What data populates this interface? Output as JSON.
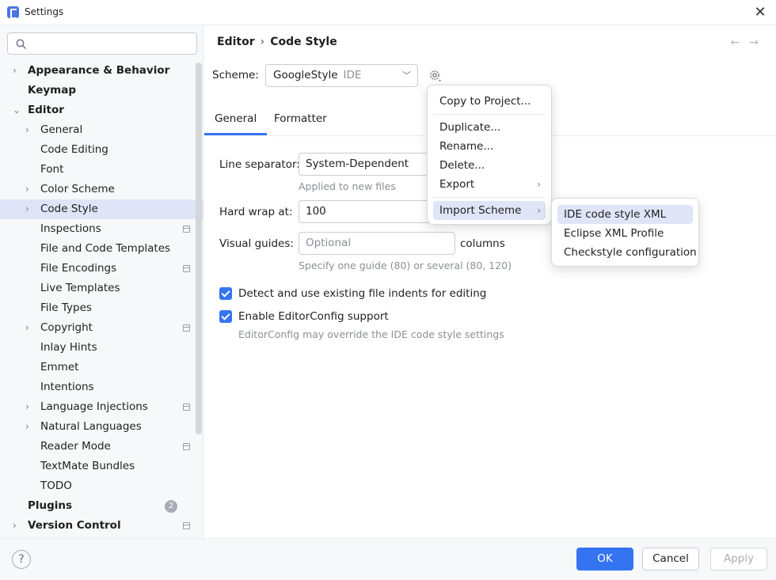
{
  "window": {
    "title": "Settings"
  },
  "sidebar": {
    "search_placeholder": "",
    "items": [
      {
        "label": "Appearance & Behavior",
        "level": 0,
        "bold": true,
        "expandable": true,
        "expanded": false
      },
      {
        "label": "Keymap",
        "level": 0,
        "bold": true,
        "expandable": false
      },
      {
        "label": "Editor",
        "level": 0,
        "bold": true,
        "expandable": true,
        "expanded": true
      },
      {
        "label": "General",
        "level": 1,
        "expandable": true,
        "expanded": false
      },
      {
        "label": "Code Editing",
        "level": 1,
        "expandable": false
      },
      {
        "label": "Font",
        "level": 1,
        "expandable": false
      },
      {
        "label": "Color Scheme",
        "level": 1,
        "expandable": true,
        "expanded": false
      },
      {
        "label": "Code Style",
        "level": 1,
        "expandable": true,
        "expanded": false,
        "selected": true
      },
      {
        "label": "Inspections",
        "level": 1,
        "expandable": false,
        "project_icon": true
      },
      {
        "label": "File and Code Templates",
        "level": 1,
        "expandable": false
      },
      {
        "label": "File Encodings",
        "level": 1,
        "expandable": false,
        "project_icon": true
      },
      {
        "label": "Live Templates",
        "level": 1,
        "expandable": false
      },
      {
        "label": "File Types",
        "level": 1,
        "expandable": false
      },
      {
        "label": "Copyright",
        "level": 1,
        "expandable": true,
        "expanded": false,
        "project_icon": true
      },
      {
        "label": "Inlay Hints",
        "level": 1,
        "expandable": false
      },
      {
        "label": "Emmet",
        "level": 1,
        "expandable": false
      },
      {
        "label": "Intentions",
        "level": 1,
        "expandable": false
      },
      {
        "label": "Language Injections",
        "level": 1,
        "expandable": true,
        "expanded": false,
        "project_icon": true
      },
      {
        "label": "Natural Languages",
        "level": 1,
        "expandable": true,
        "expanded": false
      },
      {
        "label": "Reader Mode",
        "level": 1,
        "expandable": false,
        "project_icon": true
      },
      {
        "label": "TextMate Bundles",
        "level": 1,
        "expandable": false
      },
      {
        "label": "TODO",
        "level": 1,
        "expandable": false
      },
      {
        "label": "Plugins",
        "level": 0,
        "bold": true,
        "expandable": false,
        "badge": "2"
      },
      {
        "label": "Version Control",
        "level": 0,
        "bold": true,
        "expandable": true,
        "expanded": false,
        "project_icon": true
      }
    ]
  },
  "main": {
    "breadcrumb": {
      "parent": "Editor",
      "separator": "›",
      "current": "Code Style"
    },
    "nav": {
      "back": "←",
      "forward": "→"
    },
    "scheme": {
      "label": "Scheme:",
      "value": "GoogleStyle",
      "sub": "IDE"
    },
    "tabs": [
      {
        "label": "General",
        "active": true
      },
      {
        "label": "Formatter",
        "active": false
      }
    ],
    "line_separator": {
      "label": "Line separator:",
      "value": "System-Dependent",
      "hint": "Applied to new files"
    },
    "hard_wrap": {
      "label": "Hard wrap at:",
      "value": "100"
    },
    "visual_guides": {
      "label": "Visual guides:",
      "placeholder": "Optional",
      "suffix": "columns",
      "hint": "Specify one guide (80) or several (80, 120)"
    },
    "checkboxes": [
      {
        "label": "Detect and use existing file indents for editing",
        "checked": true
      },
      {
        "label": "Enable EditorConfig support",
        "checked": true,
        "hint": "EditorConfig may override the IDE code style settings"
      }
    ]
  },
  "gear_menu": {
    "items": [
      {
        "label": "Copy to Project..."
      },
      {
        "label": "Duplicate..."
      },
      {
        "label": "Rename..."
      },
      {
        "label": "Delete..."
      },
      {
        "label": "Export",
        "submenu": true
      },
      {
        "label": "Import Scheme",
        "submenu": true,
        "highlighted": true
      }
    ]
  },
  "import_submenu": {
    "items": [
      {
        "label": "IDE code style XML",
        "highlighted": true
      },
      {
        "label": "Eclipse XML Profile"
      },
      {
        "label": "Checkstyle configuration"
      }
    ]
  },
  "footer": {
    "help": "?",
    "ok": "OK",
    "cancel": "Cancel",
    "apply": "Apply"
  },
  "colors": {
    "accent": "#3574f0",
    "selection": "#dfe5f7",
    "sidebar_bg": "#f7f8fa"
  }
}
